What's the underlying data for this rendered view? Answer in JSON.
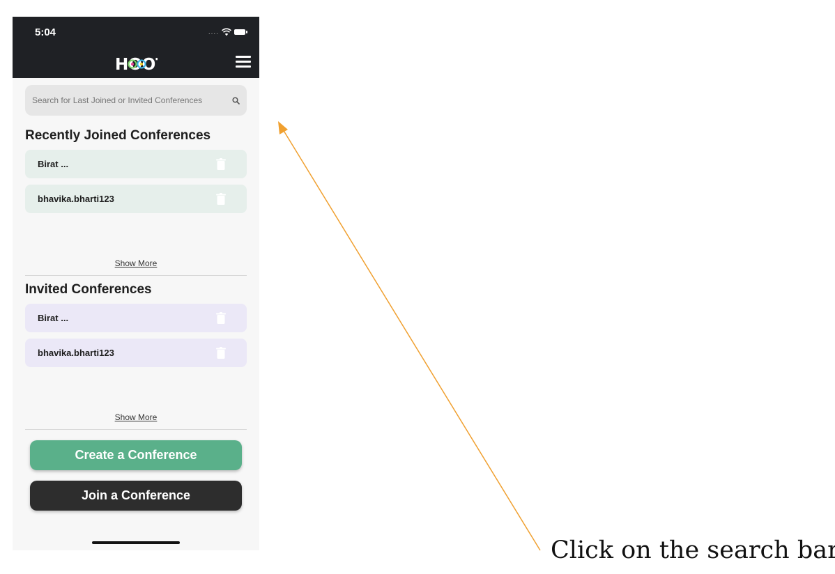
{
  "status_bar": {
    "time": "5:04"
  },
  "header": {
    "logo_text": "HOOT",
    "menu_icon": "hamburger-menu-icon"
  },
  "search": {
    "placeholder": "Search for Last Joined or Invited Conferences",
    "icon": "search-icon"
  },
  "recent": {
    "title": "Recently Joined Conferences",
    "items": [
      {
        "label": "Birat ..."
      },
      {
        "label": "bhavika.bharti123"
      }
    ],
    "show_more": "Show More"
  },
  "invited": {
    "title": "Invited Conferences",
    "items": [
      {
        "label": "Birat ..."
      },
      {
        "label": "bhavika.bharti123"
      }
    ],
    "show_more": "Show More"
  },
  "actions": {
    "create_label": "Create a Conference",
    "join_label": "Join a Conference"
  },
  "annotation": {
    "instruction": "Click on the search bar",
    "arrow_color": "#f0a030"
  },
  "colors": {
    "topbar": "#1f2125",
    "create_button": "#5ab08a",
    "join_button": "#2d2d2d",
    "recent_card": "#e6efeb",
    "invited_card": "#ebe8f7"
  }
}
